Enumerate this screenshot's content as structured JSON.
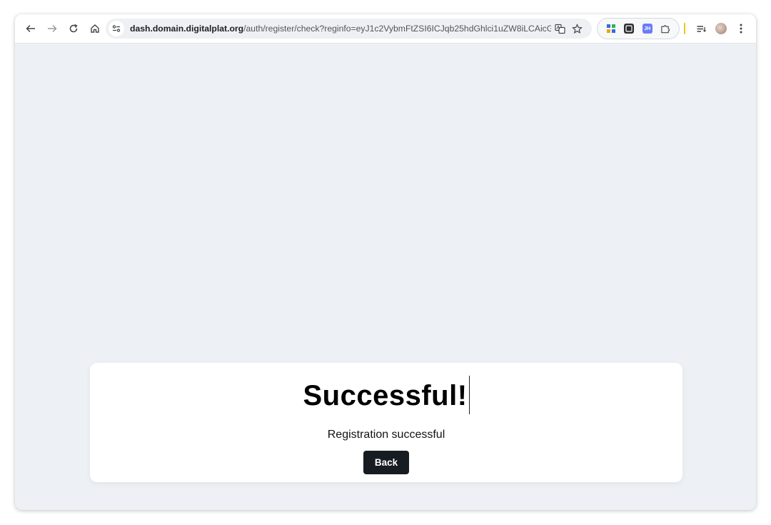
{
  "browser": {
    "url_host": "dash.domain.digitalplat.org",
    "url_path": "/auth/register/check?reginfo=eyJ1c2VybmFtZSI6ICJqb25hdGhlci1uZW8iLCAicG...",
    "icons": {
      "back": "back-arrow-icon",
      "forward": "forward-arrow-icon",
      "reload": "reload-icon",
      "home": "home-icon",
      "site_info": "site-info-icon",
      "translate": "translate-icon",
      "bookmark": "star-icon",
      "extensions": "extensions-puzzle-icon",
      "reading_list": "reading-list-icon",
      "menu": "kebab-menu-icon"
    },
    "extension_labels": [
      "",
      "",
      "JH"
    ],
    "colors": {
      "ext_1": "#3b82f6",
      "ext_2": "#2d2d2d",
      "ext_3": "#6b7cf6"
    }
  },
  "page": {
    "title": "Successful!",
    "message": "Registration successful",
    "back_label": "Back",
    "colors": {
      "background": "#edf1f5",
      "card": "#ffffff",
      "button": "#171b22"
    }
  }
}
